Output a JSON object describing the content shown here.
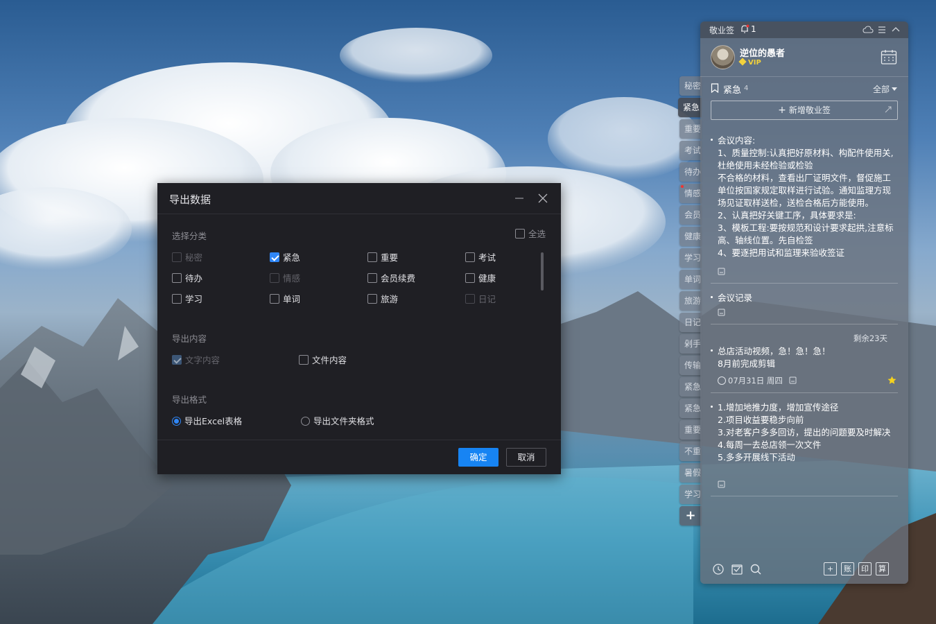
{
  "dialog": {
    "title": "导出数据",
    "sections": {
      "category_label": "选择分类",
      "content_label": "导出内容",
      "format_label": "导出格式"
    },
    "select_all": "全选",
    "categories": [
      {
        "label": "秘密",
        "checked": false,
        "disabled": true
      },
      {
        "label": "紧急",
        "checked": true,
        "disabled": false
      },
      {
        "label": "重要",
        "checked": false,
        "disabled": false
      },
      {
        "label": "考试",
        "checked": false,
        "disabled": false
      },
      {
        "label": "待办",
        "checked": false,
        "disabled": false
      },
      {
        "label": "情感",
        "checked": false,
        "disabled": true
      },
      {
        "label": "会员续费",
        "checked": false,
        "disabled": false
      },
      {
        "label": "健康",
        "checked": false,
        "disabled": false
      },
      {
        "label": "学习",
        "checked": false,
        "disabled": false
      },
      {
        "label": "单词",
        "checked": false,
        "disabled": false
      },
      {
        "label": "旅游",
        "checked": false,
        "disabled": false
      },
      {
        "label": "日记",
        "checked": false,
        "disabled": true
      }
    ],
    "contents": [
      {
        "label": "文字内容",
        "checked": true,
        "disabled": true
      },
      {
        "label": "文件内容",
        "checked": false,
        "disabled": false
      }
    ],
    "formats": [
      {
        "label": "导出Excel表格",
        "selected": true
      },
      {
        "label": "导出文件夹格式",
        "selected": false
      }
    ],
    "ok_label": "确定",
    "cancel_label": "取消"
  },
  "side_tabs": [
    "秘密",
    "紧急",
    "重要",
    "考试",
    "待办",
    "情感",
    "会员",
    "健康",
    "学习",
    "单词",
    "旅游",
    "日记",
    "剁手",
    "传输",
    "紧急",
    "紧急",
    "重要",
    "不重",
    "暑假",
    "学习"
  ],
  "side_tab_add": "+",
  "panel": {
    "app_title": "敬业签",
    "notification_count": "1",
    "user_name": "逆位的愚者",
    "vip_label": "VIP",
    "category": {
      "name": "紧急",
      "count": "4",
      "filter": "全部"
    },
    "new_note_label": "新增敬业签",
    "notes": [
      {
        "lines": [
          "会议内容:",
          "1、质量控制:认真把好原材料、构配件使用关,杜绝使用未经检验或检验",
          "不合格的材料，查看出厂证明文件，督促施工单位按国家规定取样进行试验。通知监理方现场见证取样送检，送检合格后方能使用。",
          "2、认真把好关键工序，具体要求是:",
          "3、模板工程:要按规范和设计要求起拱,注意标高、轴线位置。先自检签",
          "4、要逐把用试和监理来验收签证"
        ]
      },
      {
        "lines": [
          "会议记录"
        ]
      },
      {
        "remaining": "剩余23天",
        "lines": [
          "总店活动视频，急！急！急！",
          "8月前完成剪辑"
        ],
        "date": "07月31日 周四"
      },
      {
        "lines": [
          "1.增加地推力度，增加宣传途径",
          "2.项目收益要稳步向前",
          "3.对老客户多多回访，提出的问题要及时解决",
          "4.每周一去总店领一次文件",
          "5.多多开展线下活动"
        ]
      }
    ],
    "bottom_tools": [
      "账",
      "印",
      "算"
    ],
    "colors": {
      "accent": "#1784f3",
      "star": "#f5d21e",
      "notify_dot": "#e33333"
    }
  }
}
